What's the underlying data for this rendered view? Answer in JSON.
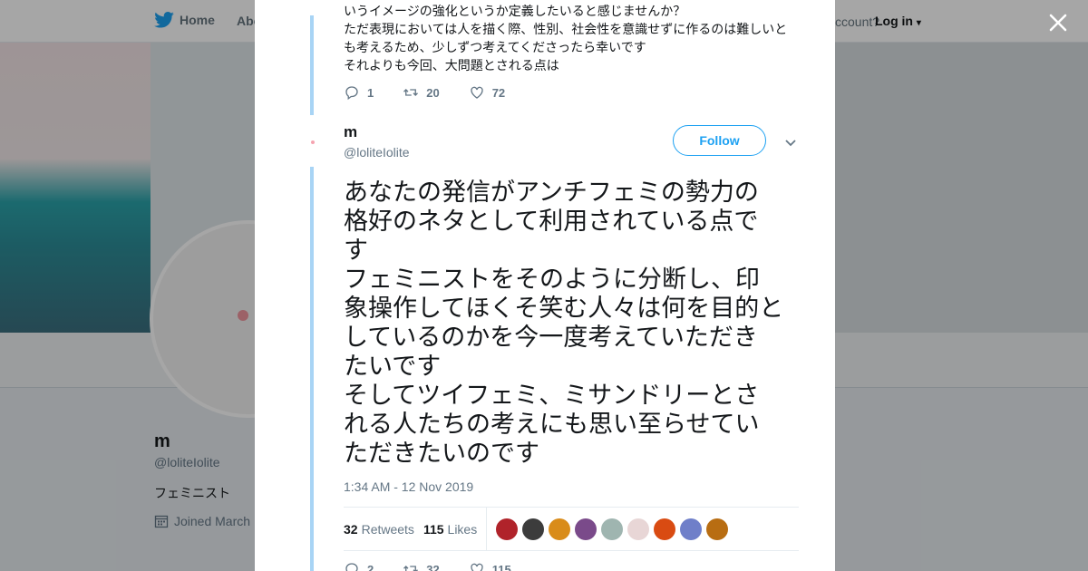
{
  "nav": {
    "home_label": "Home",
    "about_label": "Abo",
    "account_question": "ccount?",
    "login_label": "Log in"
  },
  "profile": {
    "name": "m",
    "handle": "@loliteIolite",
    "bio": "フェミニスト",
    "joined": "Joined March"
  },
  "prev_tweet": {
    "lines": [
      "いうイメージの強化というか定義したいると感じませんか？",
      "ただ表現においては人を描く際、性別、社会性を意識せずに作るのは難しいと",
      "も考えるため、少しずつ考えてくださったら幸いです",
      "それよりも今回、大問題とされる点は"
    ],
    "replies": "1",
    "retweets": "20",
    "likes": "72"
  },
  "tweet": {
    "author_name": "m",
    "author_handle": "@loliteIolite",
    "follow_label": "Follow",
    "lines": [
      "あなたの発信がアンチフェミの勢力の",
      "格好のネタとして利用されている点で",
      "す",
      "フェミニストをそのように分断し、印",
      "象操作してほくそ笑む人々は何を目的と",
      "しているのかを今一度考えていただき",
      "たいです",
      "そしてツイフェミ、ミサンドリーとさ",
      "れる人たちの考えにも思い至らせてい",
      "ただきたいのです"
    ],
    "timestamp": "1:34 AM - 12 Nov 2019",
    "retweet_count": "32",
    "retweet_label": "Retweets",
    "like_count": "115",
    "like_label": "Likes",
    "replies": "2",
    "retweets": "32",
    "likes": "115"
  },
  "colors": {
    "accent": "#1da1f2",
    "thread_line": "#a8d4f5",
    "muted_text": "#657786"
  },
  "likers": [
    "#b0232a",
    "#3c3c3c",
    "#d98c1a",
    "#7a4a8a",
    "#9fb5b0",
    "#e8d6d6",
    "#d94b12",
    "#6f7fc9",
    "#b86d12"
  ]
}
